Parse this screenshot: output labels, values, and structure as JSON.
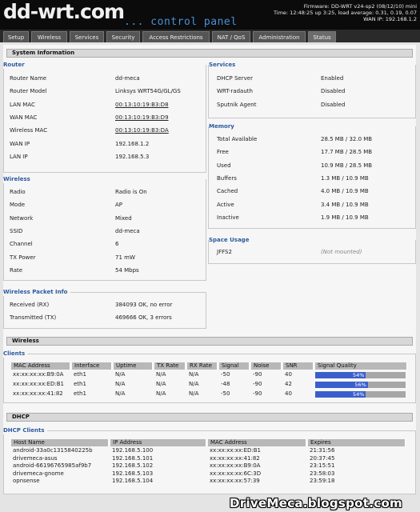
{
  "header": {
    "logo": "dd-wrt.com",
    "subtitle": "... control panel",
    "firmware": "Firmware: DD-WRT v24-sp2 (08/12/10) mini",
    "time": "Time: 12:48:25 up 3:25, load average: 0.31, 0.19, 0.07",
    "wan_ip": "WAN IP: 192.168.1.2"
  },
  "tabs": [
    "Setup",
    "Wireless",
    "Services",
    "Security",
    "Access Restrictions",
    "NAT / QoS",
    "Administration",
    "Status"
  ],
  "system_info": {
    "title": "System Information",
    "router": {
      "legend": "Router",
      "rows": [
        {
          "k": "Router Name",
          "v": "dd-meca"
        },
        {
          "k": "Router Model",
          "v": "Linksys WRT54G/GL/GS"
        },
        {
          "k": "LAN MAC",
          "v": "00:13:10:19:B3:D8"
        },
        {
          "k": "WAN MAC",
          "v": "00:13:10:19:B3:D9"
        },
        {
          "k": "Wireless MAC",
          "v": "00:13:10:19:B3:DA"
        },
        {
          "k": "WAN IP",
          "v": "192.168.1.2"
        },
        {
          "k": "LAN IP",
          "v": "192.168.5.3"
        }
      ]
    },
    "wireless": {
      "legend": "Wireless",
      "rows": [
        {
          "k": "Radio",
          "v": "Radio is On"
        },
        {
          "k": "Mode",
          "v": "AP"
        },
        {
          "k": "Network",
          "v": "Mixed"
        },
        {
          "k": "SSID",
          "v": "dd-meca"
        },
        {
          "k": "Channel",
          "v": "6"
        },
        {
          "k": "TX Power",
          "v": "71 mW"
        },
        {
          "k": "Rate",
          "v": "54 Mbps"
        }
      ]
    },
    "packet_info": {
      "legend": "Wireless Packet Info",
      "rows": [
        {
          "k": "Received (RX)",
          "v": "384093 OK, no error"
        },
        {
          "k": "Transmitted (TX)",
          "v": "469666 OK, 3 errors"
        }
      ]
    },
    "services": {
      "legend": "Services",
      "rows": [
        {
          "k": "DHCP Server",
          "v": "Enabled"
        },
        {
          "k": "WRT-radauth",
          "v": "Disabled"
        },
        {
          "k": "Sputnik Agent",
          "v": "Disabled"
        }
      ]
    },
    "memory": {
      "legend": "Memory",
      "rows": [
        {
          "k": "Total Available",
          "v": "28.5 MB / 32.0 MB"
        },
        {
          "k": "Free",
          "v": "17.7 MB / 28.5 MB"
        },
        {
          "k": "Used",
          "v": "10.9 MB / 28.5 MB"
        },
        {
          "k": "Buffers",
          "v": "1.3 MB / 10.9 MB"
        },
        {
          "k": "Cached",
          "v": "4.0 MB / 10.9 MB"
        },
        {
          "k": "Active",
          "v": "3.4 MB / 10.9 MB"
        },
        {
          "k": "Inactive",
          "v": "1.9 MB / 10.9 MB"
        }
      ]
    },
    "space": {
      "legend": "Space Usage",
      "rows": [
        {
          "k": "JFFS2",
          "v": "(Not mounted)"
        }
      ]
    }
  },
  "wireless_section": {
    "title": "Wireless",
    "legend": "Clients",
    "columns": [
      "MAC Address",
      "Interface",
      "Uptime",
      "TX Rate",
      "RX Rate",
      "Signal",
      "Noise",
      "SNR",
      "Signal Quality"
    ],
    "rows": [
      {
        "mac": "xx:xx:xx:xx:B9:0A",
        "iface": "eth1",
        "uptime": "N/A",
        "tx": "N/A",
        "rx": "N/A",
        "signal": "-50",
        "noise": "-90",
        "snr": "40",
        "quality": "54%",
        "quality_frac": 0.54
      },
      {
        "mac": "xx:xx:xx:xx:ED:B1",
        "iface": "eth1",
        "uptime": "N/A",
        "tx": "N/A",
        "rx": "N/A",
        "signal": "-48",
        "noise": "-90",
        "snr": "42",
        "quality": "56%",
        "quality_frac": 0.56
      },
      {
        "mac": "xx:xx:xx:xx:41:82",
        "iface": "eth1",
        "uptime": "N/A",
        "tx": "N/A",
        "rx": "N/A",
        "signal": "-50",
        "noise": "-90",
        "snr": "40",
        "quality": "54%",
        "quality_frac": 0.54
      }
    ]
  },
  "dhcp": {
    "title": "DHCP",
    "legend": "DHCP Clients",
    "columns": [
      "Host Name",
      "IP Address",
      "MAC Address",
      "Expires"
    ],
    "rows": [
      {
        "host": "android-33a0c1315840225b",
        "ip": "192.168.5.100",
        "mac": "xx:xx:xx:xx:ED:B1",
        "exp": "21:31:56"
      },
      {
        "host": "drivemeca-asus",
        "ip": "192.168.5.101",
        "mac": "xx:xx:xx:xx:41:82",
        "exp": "20:37:45"
      },
      {
        "host": "android-66196765985af9b7",
        "ip": "192.168.5.102",
        "mac": "xx:xx:xx:xx:B9:0A",
        "exp": "23:15:51"
      },
      {
        "host": "drivemeca-gnome",
        "ip": "192.168.5.103",
        "mac": "xx:xx:xx:xx:6C:3D",
        "exp": "23:58:03"
      },
      {
        "host": "opnsense",
        "ip": "192.168.5.104",
        "mac": "xx:xx:xx:xx:57:39",
        "exp": "23:59:18"
      }
    ]
  },
  "watermark": "DriveMeca.blogspot.com"
}
